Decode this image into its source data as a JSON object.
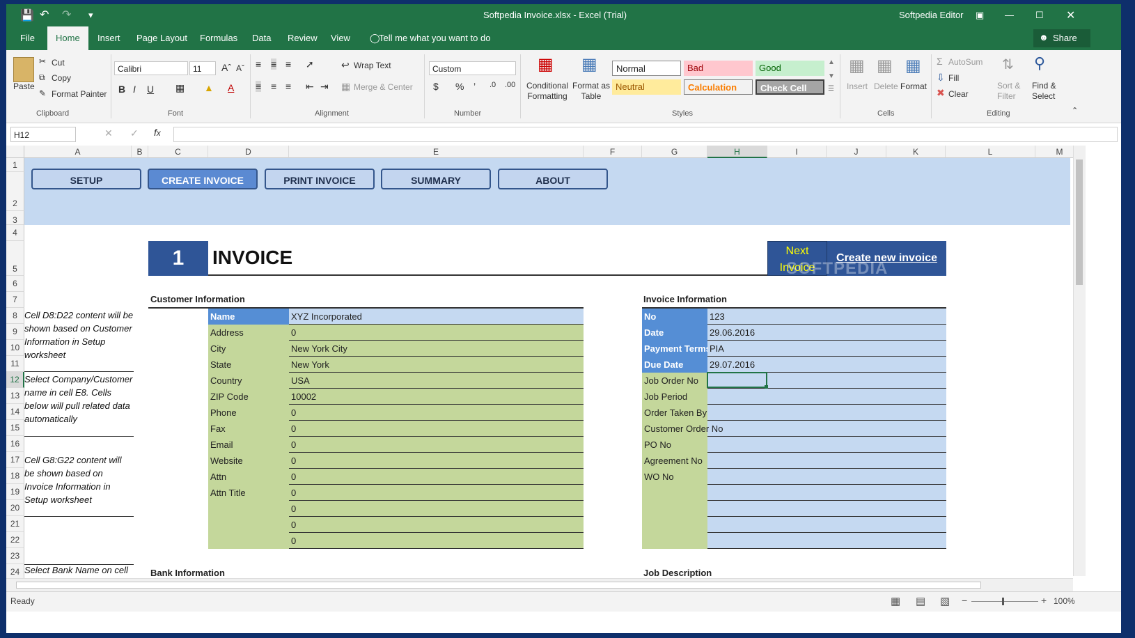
{
  "titlebar": {
    "doc_title": "Softpedia Invoice.xlsx - Excel (Trial)",
    "user": "Softpedia Editor"
  },
  "tabs": [
    "File",
    "Home",
    "Insert",
    "Page Layout",
    "Formulas",
    "Data",
    "Review",
    "View"
  ],
  "tell_me": "Tell me what you want to do",
  "share": "Share",
  "ribbon": {
    "clipboard": {
      "paste": "Paste",
      "cut": "Cut",
      "copy": "Copy",
      "format_painter": "Format Painter",
      "label": "Clipboard"
    },
    "font": {
      "name": "Calibri",
      "size": "11",
      "label": "Font"
    },
    "alignment": {
      "wrap": "Wrap Text",
      "merge": "Merge & Center",
      "label": "Alignment"
    },
    "number": {
      "format": "Custom",
      "label": "Number"
    },
    "styles": {
      "conditional": "Conditional Formatting",
      "format_table": "Format as Table",
      "normal": "Normal",
      "bad": "Bad",
      "good": "Good",
      "neutral": "Neutral",
      "calculation": "Calculation",
      "check_cell": "Check Cell",
      "label": "Styles"
    },
    "cells": {
      "insert": "Insert",
      "delete": "Delete",
      "format": "Format",
      "label": "Cells"
    },
    "editing": {
      "autosum": "AutoSum",
      "fill": "Fill",
      "clear": "Clear",
      "sort": "Sort & Filter",
      "find": "Find & Select",
      "label": "Editing"
    }
  },
  "formula_bar": {
    "name_box": "H12",
    "formula": ""
  },
  "columns": [
    "A",
    "B",
    "C",
    "D",
    "E",
    "F",
    "G",
    "H",
    "I",
    "J",
    "K",
    "L",
    "M"
  ],
  "rows": [
    "1",
    "2",
    "3",
    "4",
    "5",
    "6",
    "7",
    "8",
    "9",
    "10",
    "11",
    "12",
    "13",
    "14",
    "15",
    "16",
    "17",
    "18",
    "19",
    "20",
    "21",
    "22",
    "23",
    "24"
  ],
  "nav_buttons": [
    "SETUP",
    "CREATE INVOICE",
    "PRINT INVOICE",
    "SUMMARY",
    "ABOUT"
  ],
  "invoice": {
    "number": "1",
    "title": "INVOICE",
    "next_invoice": "Next Invoice",
    "create_new": "Create new invoice",
    "watermark": "SOFTPEDIA"
  },
  "customer": {
    "heading": "Customer Information",
    "fields": [
      {
        "label": "Name",
        "value": "XYZ Incorporated"
      },
      {
        "label": "Address",
        "value": "0"
      },
      {
        "label": "City",
        "value": "New York City"
      },
      {
        "label": "State",
        "value": "New York"
      },
      {
        "label": "Country",
        "value": "USA"
      },
      {
        "label": "ZIP Code",
        "value": "10002"
      },
      {
        "label": "Phone",
        "value": "0"
      },
      {
        "label": "Fax",
        "value": "0"
      },
      {
        "label": "Email",
        "value": "0"
      },
      {
        "label": "Website",
        "value": "0"
      },
      {
        "label": "Attn",
        "value": "0"
      },
      {
        "label": "Attn Title",
        "value": "0"
      },
      {
        "label": "",
        "value": "0"
      },
      {
        "label": "",
        "value": "0"
      },
      {
        "label": "",
        "value": "0"
      }
    ]
  },
  "invoice_info": {
    "heading": "Invoice Information",
    "fields": [
      {
        "label": "No",
        "value": "123"
      },
      {
        "label": "Date",
        "value": "29.06.2016"
      },
      {
        "label": "Payment Terms",
        "value": "PIA"
      },
      {
        "label": "Due Date",
        "value": "29.07.2016"
      },
      {
        "label": "Job Order No",
        "value": ""
      },
      {
        "label": "Job Period",
        "value": ""
      },
      {
        "label": "Order Taken By",
        "value": ""
      },
      {
        "label": "Customer Order No",
        "value": ""
      },
      {
        "label": "PO No",
        "value": ""
      },
      {
        "label": "Agreement No",
        "value": ""
      },
      {
        "label": "WO No",
        "value": ""
      },
      {
        "label": "",
        "value": ""
      },
      {
        "label": "",
        "value": ""
      },
      {
        "label": "",
        "value": ""
      },
      {
        "label": "",
        "value": ""
      }
    ]
  },
  "notes": [
    "Cell D8:D22 content will be shown based on Customer Information in Setup worksheet",
    "Select Company/Customer name in cell E8. Cells below will pull related data automatically",
    "Cell G8:G22 content will be shown based on Invoice Information in Setup worksheet",
    "Select Bank Name on cell"
  ],
  "bottom_headings": {
    "bank": "Bank Information",
    "job": "Job Description"
  },
  "status": {
    "ready": "Ready",
    "zoom": "100%"
  }
}
